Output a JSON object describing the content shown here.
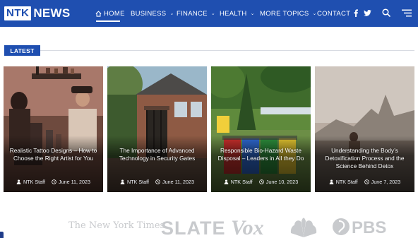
{
  "brand": {
    "logo_box": "NTK",
    "logo_word": "NEWS"
  },
  "nav": {
    "home": "HOME",
    "business": "BUSINESS",
    "finance": "FINANCE",
    "health": "HEALTH",
    "more_topics": "MORE TOPICS",
    "contact": "CONTACT"
  },
  "header_icons": [
    "home-icon",
    "chevron-down-icon",
    "facebook-icon",
    "twitter-icon",
    "search-icon",
    "menu-icon"
  ],
  "section": {
    "latest": "LATEST"
  },
  "articles": [
    {
      "title": "Realistic Tattoo Designs – How to Choose the Right Artist for You",
      "author": "NTK Staff",
      "date": "June 11, 2023"
    },
    {
      "title": "The Importance of Advanced Technology in Security Gates",
      "author": "NTK Staff",
      "date": "June 11, 2023"
    },
    {
      "title": "Responsible Bio-Hazard Waste Disposal – Leaders in All they Do",
      "author": "NTK Staff",
      "date": "June 10, 2023"
    },
    {
      "title": "Understanding the Body’s Detoxification Process and the Science Behind Detox",
      "author": "NTK Staff",
      "date": "June 7, 2023"
    }
  ],
  "press_logos": {
    "nyt": "The New York Times",
    "slate": "SLATE",
    "vox": "Vox",
    "pbs": "PBS"
  },
  "colors": {
    "brand_blue": "#1f4fb0",
    "logo_gray": "#c8cacd"
  }
}
